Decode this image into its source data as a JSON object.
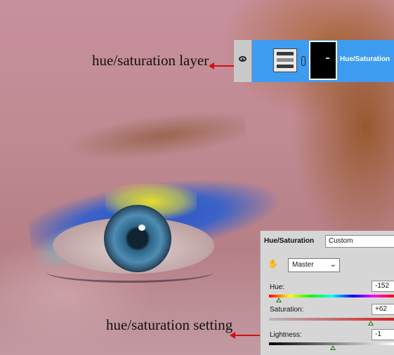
{
  "annotations": {
    "layer_label": "hue/saturation layer",
    "setting_label": "hue/saturation setting",
    "arrow_color": "#d11010"
  },
  "layers_panel": {
    "layer_name": "Hue/Saturation",
    "selected_color": "#3d9cf0",
    "visibility_icon": "eye-icon",
    "adjustment_icon": "hue-saturation-adjustment-icon",
    "link_icon": "chain-link-icon"
  },
  "adjustments_panel": {
    "title": "Hue/Saturation",
    "preset": "Custom",
    "target_tool_icon": "hand-target-icon",
    "channel": "Master",
    "hue": {
      "label": "Hue:",
      "value": "-152",
      "slider_fraction": 0.08
    },
    "saturation": {
      "label": "Saturation:",
      "value": "+62",
      "slider_fraction": 0.81
    },
    "lightness": {
      "label": "Lightness:",
      "value": "-1",
      "slider_fraction": 0.51
    }
  }
}
